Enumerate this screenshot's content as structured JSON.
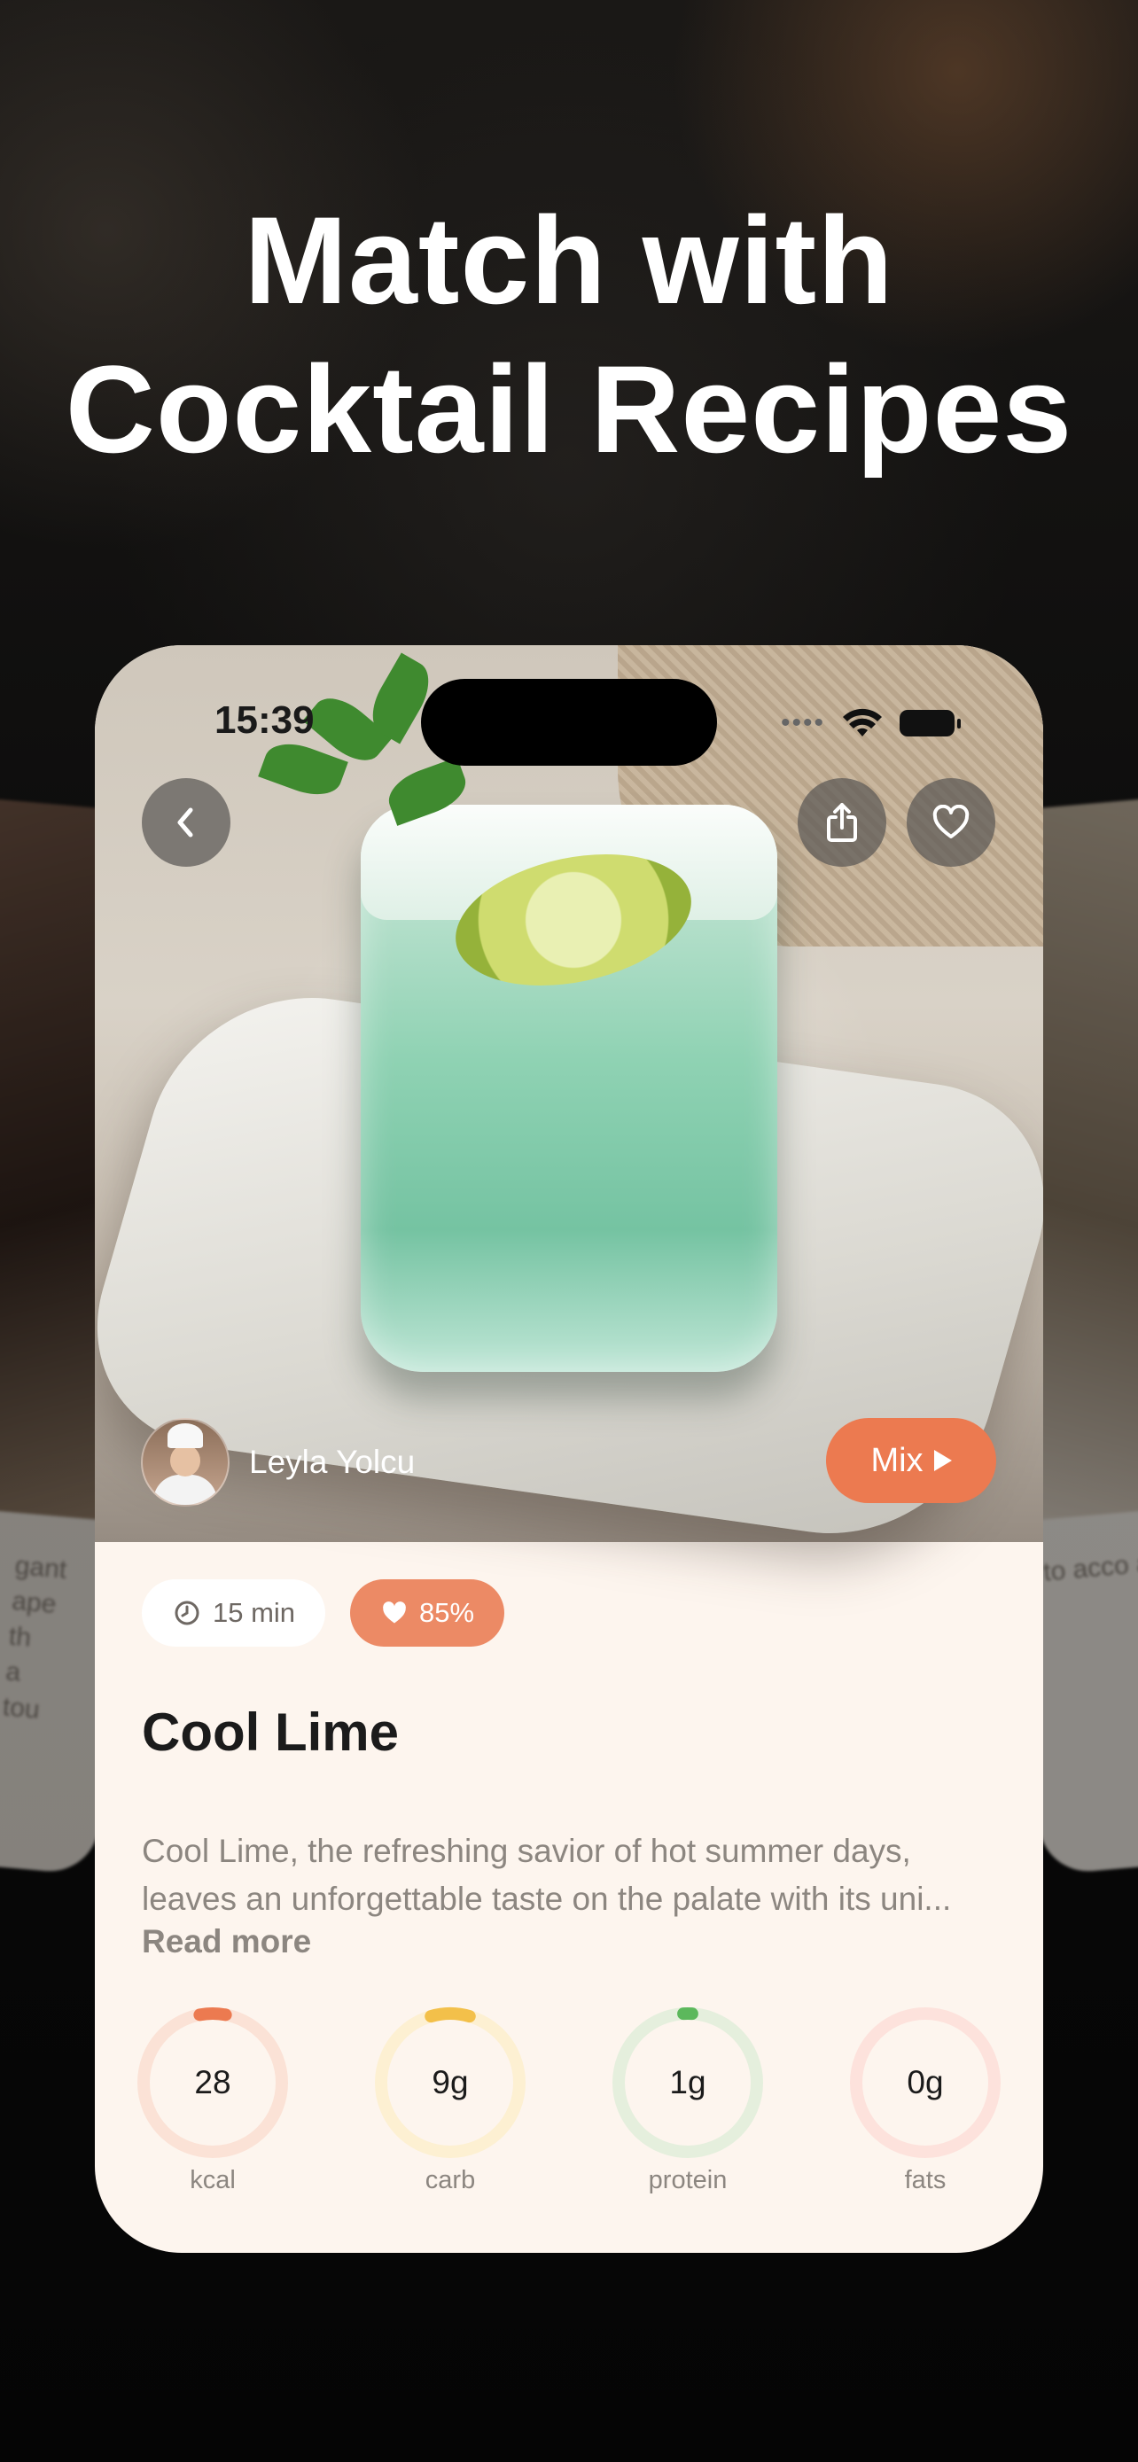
{
  "headline": {
    "line1": "Match with",
    "line2": "Cocktail Recipes"
  },
  "side_cards": {
    "left_snippet": "gant ape th a tou",
    "right_snippet": "to acco ay. Its s"
  },
  "status_bar": {
    "time": "15:39"
  },
  "hero": {
    "author_name": "Leyla Yolcu",
    "mix_label": "Mix"
  },
  "recipe": {
    "time_chip": "15 min",
    "likes_chip": "85%",
    "title": "Cool Lime",
    "description_line1": "Cool Lime, the refreshing savior of hot summer days,",
    "description_line2": "leaves an unforgettable taste on the palate with its uni...",
    "read_more": "Read more"
  },
  "macros": [
    {
      "value": "28",
      "label": "kcal",
      "fraction": 0.06,
      "color": "#ec7a50",
      "track": "#fbe2d6"
    },
    {
      "value": "9g",
      "label": "carb",
      "fraction": 0.09,
      "color": "#f3c04a",
      "track": "#fdf0d2"
    },
    {
      "value": "1g",
      "label": "protein",
      "fraction": 0.02,
      "color": "#5cb85c",
      "track": "#e5efdd"
    },
    {
      "value": "0g",
      "label": "fats",
      "fraction": 0.0,
      "color": "#f08a7a",
      "track": "#fde2dc"
    }
  ]
}
